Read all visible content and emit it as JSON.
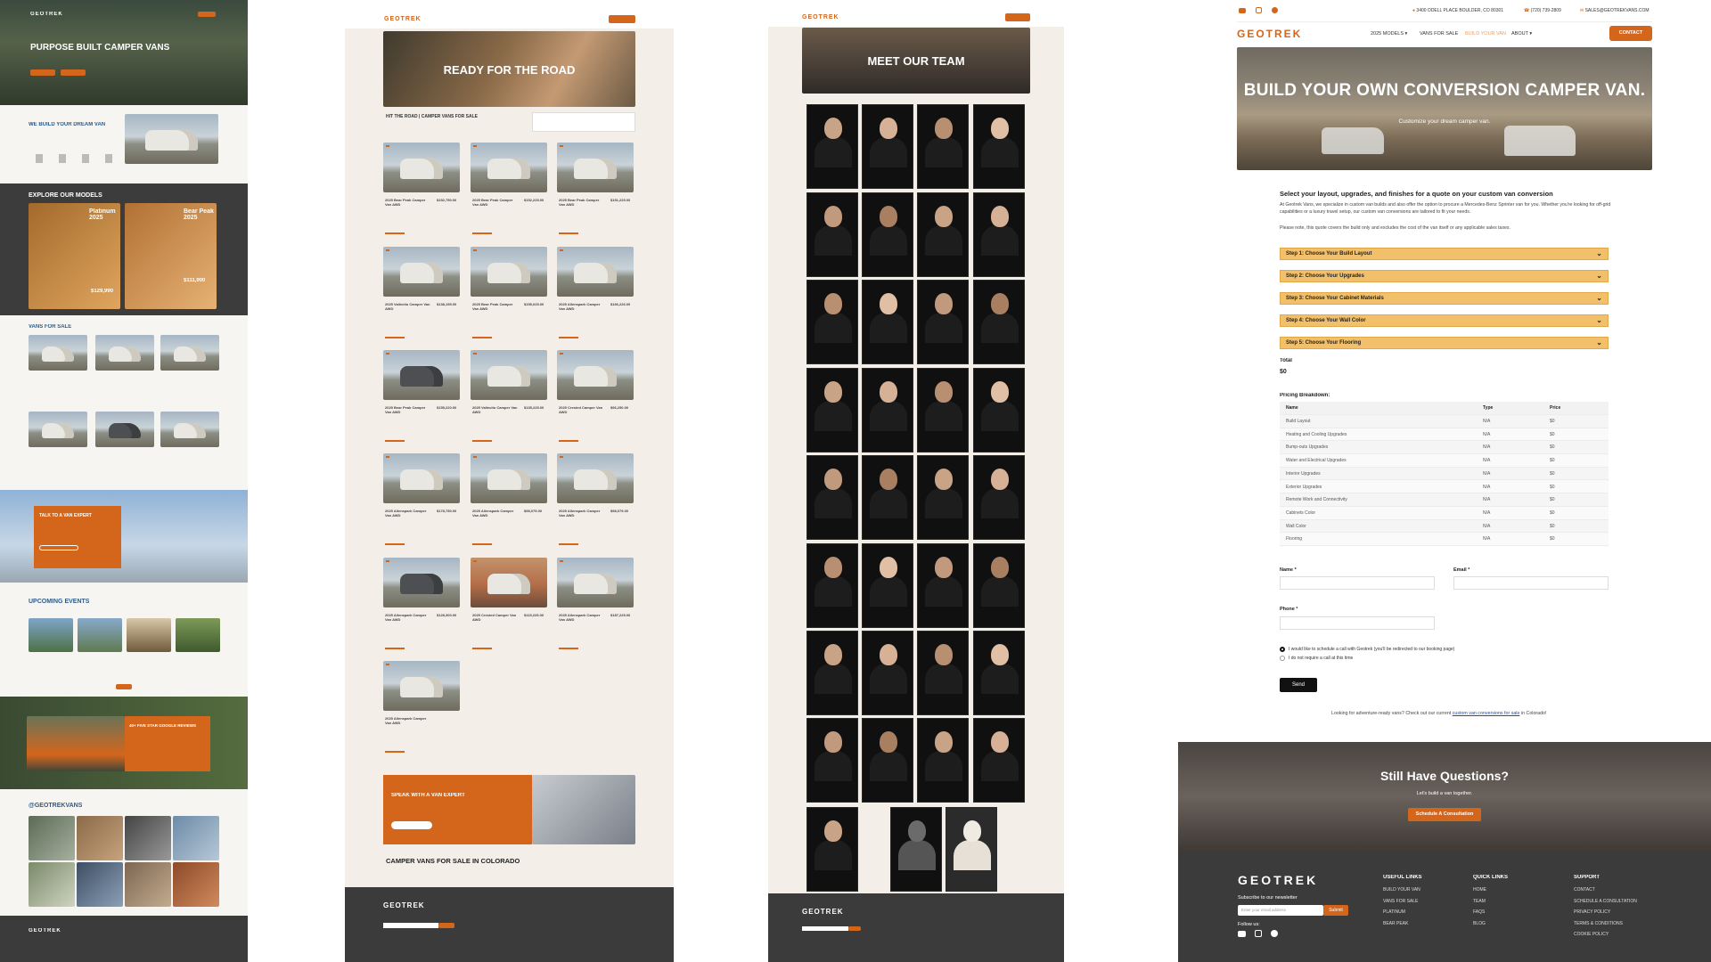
{
  "brand": "GEOTREK",
  "colors": {
    "accent": "#d4661c",
    "dark": "#3b3b3b",
    "step": "#f2c06a"
  },
  "p1": {
    "hero_title": "PURPOSE BUILT CAMPER VANS",
    "dream_title": "WE BUILD YOUR DREAM VAN",
    "explore_title": "EXPLORE OUR MODELS",
    "model1": {
      "name": "Platinum 2025",
      "price": "$129,990"
    },
    "model2": {
      "name": "Bear Peak 2025",
      "price": "$111,900"
    },
    "vans_title": "VANS FOR SALE",
    "talk_title": "TALK TO A VAN EXPERT",
    "events_title": "UPCOMING EVENTS",
    "reviews_title": "40+ FIVE STAR GOOGLE REVIEWS",
    "insta_title": "@GEOTREKVANS"
  },
  "p2": {
    "hero_title": "READY FOR THE ROAD",
    "subtitle": "HIT THE ROAD | CAMPER VANS FOR SALE",
    "listings": [
      {
        "title": "2025 Bear Peak Camper Van AWD",
        "price": "$152,750.00"
      },
      {
        "title": "2025 Bear Peak Camper Van AWD",
        "price": "$152,225.00"
      },
      {
        "title": "2025 Bear Peak Camper Van AWD",
        "price": "$151,225.00"
      },
      {
        "title": "2025 Vallecito Camper Van AWD",
        "price": "$138,195.00"
      },
      {
        "title": "2025 Bear Peak Camper Van AWD",
        "price": "$155,025.00"
      },
      {
        "title": "2025 Allenspark Camper Van AWD",
        "price": "$166,226.00"
      },
      {
        "title": "2025 Bear Peak Camper Van AWD",
        "price": "$155,220.00"
      },
      {
        "title": "2025 Vallecito Camper Van AWD",
        "price": "$135,225.00"
      },
      {
        "title": "2025 Crested Camper Van AWD",
        "price": "$96,250.00"
      },
      {
        "title": "2025 Allenspark Camper Van AWD",
        "price": "$178,750.00"
      },
      {
        "title": "2025 Allenspark Camper Van AWD",
        "price": "$98,079.00"
      },
      {
        "title": "2025 Allenspark Camper Van AWD",
        "price": "$98,079.00"
      },
      {
        "title": "2025 Allenspark Camper Van AWD",
        "price": "$128,300.00"
      },
      {
        "title": "2025 Crested Camper Van AWD",
        "price": "$115,225.00"
      },
      {
        "title": "2025 Allenspark Camper Van AWD",
        "price": "$187,225.00"
      },
      {
        "title": "2025 Allenspark Camper Van AWD",
        "price": ""
      }
    ],
    "speak_title": "SPEAK WITH A VAN EXPERT",
    "colorado_title": "CAMPER VANS FOR SALE IN COLORADO"
  },
  "p3": {
    "hero_title": "MEET OUR TEAM"
  },
  "p4": {
    "topbar": {
      "address": "3400 ODELL PLACE BOULDER, CO 80301",
      "phone": "(720) 739-2809",
      "email": "SALES@GEOTREKVANS.COM"
    },
    "nav": {
      "models": "2025 MODELS",
      "vans": "VANS FOR SALE",
      "build": "BUILD YOUR VAN",
      "about": "ABOUT",
      "contact": "CONTACT"
    },
    "hero": {
      "title": "BUILD YOUR OWN CONVERSION CAMPER VAN.",
      "sub": "Customize your dream camper van."
    },
    "intro": {
      "heading": "Select your layout, upgrades, and finishes for a quote on your custom van conversion",
      "body": "At Geotrek Vans, we specialize in custom van builds and also offer the option to procure a Mercedes-Benz Sprinter van for you. Whether you're looking for off-grid capabilities or a luxury travel setup, our custom van conversions are tailored to fit your needs.",
      "note": "Please note, this quote covers the build only and excludes the cost of the van itself or any applicable sales taxes."
    },
    "steps": [
      "Step 1: Choose Your Build Layout",
      "Step 2: Choose Your Upgrades",
      "Step 3: Choose Your Cabinet Materials",
      "Step 4: Choose Your Wall Color",
      "Step 5: Choose Your Flooring"
    ],
    "total_label": "Total",
    "total_value": "$0",
    "breakdown_label": "Pricing Breakdown:",
    "table_head": {
      "name": "Name",
      "type": "Type",
      "price": "Price"
    },
    "rows": [
      {
        "name": "Build Layout",
        "type": "N/A",
        "price": "$0"
      },
      {
        "name": "Heating and Cooling Upgrades",
        "type": "N/A",
        "price": "$0"
      },
      {
        "name": "Bump-outs Upgrades",
        "type": "N/A",
        "price": "$0"
      },
      {
        "name": "Water and Electrical Upgrades",
        "type": "N/A",
        "price": "$0"
      },
      {
        "name": "Interior Upgrades",
        "type": "N/A",
        "price": "$0"
      },
      {
        "name": "Exterior Upgrades",
        "type": "N/A",
        "price": "$0"
      },
      {
        "name": "Remote Work and Connectivity",
        "type": "N/A",
        "price": "$0"
      },
      {
        "name": "Cabinets Color",
        "type": "N/A",
        "price": "$0"
      },
      {
        "name": "Wall Color",
        "type": "N/A",
        "price": "$0"
      },
      {
        "name": "Flooring",
        "type": "N/A",
        "price": "$0"
      }
    ],
    "form": {
      "name_label": "Name *",
      "email_label": "Email *",
      "phone_label": "Phone *",
      "opt1": "I would like to schedule a call with Geotrek (you'll be redirected to our booking page)",
      "opt2": "I do not require a call at this time",
      "send": "Send"
    },
    "adventure_text": "Looking for adventure-ready vans? Check out our current",
    "adventure_link": "custom van conversions for sale",
    "adventure_tail": "in Colorado!",
    "cta": {
      "title": "Still Have Questions?",
      "sub": "Let's build a van together.",
      "button": "Schedule A Consultation"
    },
    "footer": {
      "subscribe_label": "Subscribe to our newsletter",
      "email_placeholder": "Enter your email address",
      "submit": "Submit",
      "follow": "Follow us:",
      "useful_title": "USEFUL LINKS",
      "useful": [
        "BUILD YOUR VAN",
        "VANS FOR SALE",
        "PLATINUM",
        "BEAR PEAK"
      ],
      "quick_title": "QUICK LINKS",
      "quick": [
        "HOME",
        "TEAM",
        "FAQS",
        "BLOG"
      ],
      "support_title": "SUPPORT",
      "support": [
        "CONTACT",
        "SCHEDULE A CONSULTATION",
        "PRIVACY POLICY",
        "TERMS & CONDITIONS",
        "COOKIE POLICY"
      ]
    }
  }
}
